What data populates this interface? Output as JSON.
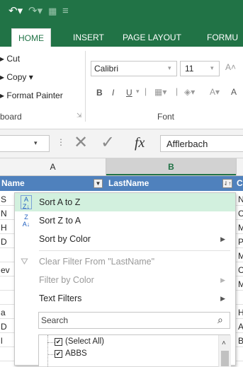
{
  "qat": {
    "undo_icon": "undo-icon",
    "redo_icon": "redo-icon"
  },
  "tabs": [
    "HOME",
    "INSERT",
    "PAGE LAYOUT",
    "FORMU"
  ],
  "clipboard": {
    "cut": "Cut",
    "copy": "Copy",
    "format_painter": "Format Painter",
    "group_label": "board"
  },
  "font": {
    "name": "Calibri",
    "size": "11",
    "bold": "B",
    "italic": "I",
    "underline": "U",
    "group_label": "Font"
  },
  "formula_bar": {
    "fx": "fx",
    "value": "Afflerbach"
  },
  "columns": [
    "A",
    "B"
  ],
  "header_row": {
    "col_a": "Name",
    "col_b": "LastName",
    "col_c": "C"
  },
  "left_chars": [
    "S",
    "N",
    "H",
    "D",
    "",
    "ev",
    "",
    "a",
    "D",
    "l"
  ],
  "right_chars": [
    "N",
    "C",
    "M",
    "P",
    "M",
    "C",
    "M",
    "H",
    "A",
    "B"
  ],
  "menu": {
    "sort_az": "Sort A to Z",
    "sort_za": "Sort Z to A",
    "sort_color": "Sort by Color",
    "clear_filter": "Clear Filter From \"LastName\"",
    "filter_color": "Filter by Color",
    "text_filters": "Text Filters",
    "search_placeholder": "Search",
    "list": [
      "(Select All)",
      "ABBS"
    ]
  },
  "colors": {
    "excel_green": "#217346",
    "highlight": "#d2f0de",
    "selected_header": "#d2d2d2"
  }
}
